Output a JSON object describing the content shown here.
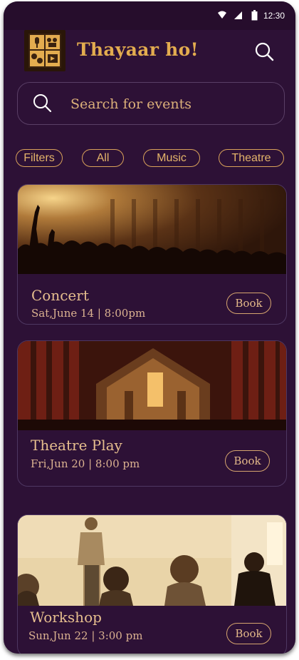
{
  "status_bar": {
    "time": "12:30"
  },
  "app": {
    "title": "Thayaar ho!"
  },
  "search": {
    "placeholder": "Search for events"
  },
  "filters": [
    {
      "label": "Filters"
    },
    {
      "label": "All"
    },
    {
      "label": "Music"
    },
    {
      "label": "Theatre"
    }
  ],
  "events": [
    {
      "title": "Concert",
      "date": "Sat,June 14 | 8:00pm",
      "book_label": "Book"
    },
    {
      "title": "Theatre Play",
      "date": "Fri,Jun 20 | 8:00 pm",
      "book_label": "Book"
    },
    {
      "title": "Workshop",
      "date": "Sun,Jun 22 | 3:00 pm",
      "book_label": "Book"
    }
  ],
  "colors": {
    "background": "#2d1136",
    "accent": "#e3ac4f",
    "text": "#e6be8e",
    "status_bar": "#260d2c"
  }
}
